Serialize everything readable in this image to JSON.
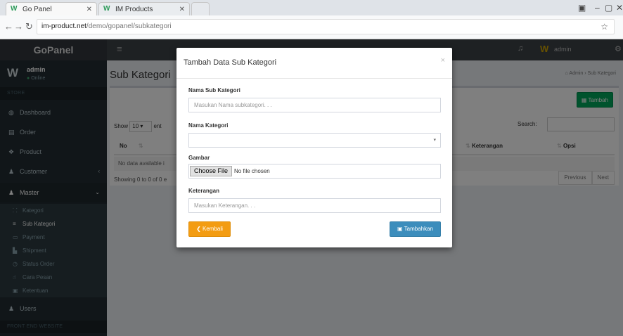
{
  "browser": {
    "tabs": [
      {
        "label": "Go Panel"
      },
      {
        "label": "IM Products"
      }
    ],
    "url_host": "im-product.net",
    "url_path": "/demo/gopanel/subkategori"
  },
  "header": {
    "brand": "GoPanel",
    "user": "admin"
  },
  "sidebar": {
    "user_name": "admin",
    "user_status": "Online",
    "section_main": "STORE",
    "items": [
      {
        "label": "Dashboard"
      },
      {
        "label": "Order"
      },
      {
        "label": "Product"
      },
      {
        "label": "Customer"
      },
      {
        "label": "Master"
      }
    ],
    "sub_items": [
      {
        "label": "Kategori"
      },
      {
        "label": "Sub Kategori"
      },
      {
        "label": "Payment"
      },
      {
        "label": "Shipment"
      },
      {
        "label": "Status Order"
      },
      {
        "label": "Cara Pesan"
      },
      {
        "label": "Ketentuan"
      }
    ],
    "users": "Users",
    "section_front": "FRONT END WEBSITE"
  },
  "content": {
    "title": "Sub Kategori",
    "breadcrumb_home": "Admin",
    "breadcrumb_current": "Sub Kategori",
    "add_button": "Tambah",
    "show_label": "Show",
    "show_value": "10",
    "entries_label": "ent",
    "search_label": "Search:",
    "columns": [
      "No",
      "Keterangan",
      "Opsi"
    ],
    "empty_text": "No data available i",
    "info_text": "Showing 0 to 0 of 0 e",
    "prev": "Previous",
    "next": "Next"
  },
  "modal": {
    "title": "Tambah Data Sub Kategori",
    "close": "×",
    "fields": {
      "nama_sub_label": "Nama Sub Kategori",
      "nama_sub_placeholder": "Masukan Nama subkategori. . .",
      "nama_kategori_label": "Nama Kategori",
      "gambar_label": "Gambar",
      "file_button": "Choose File",
      "file_status": "No file chosen",
      "keterangan_label": "Keterangan",
      "keterangan_placeholder": "Masukan Keterangan. . ."
    },
    "back_button": "Kembali",
    "save_button": "Tambahkan"
  }
}
